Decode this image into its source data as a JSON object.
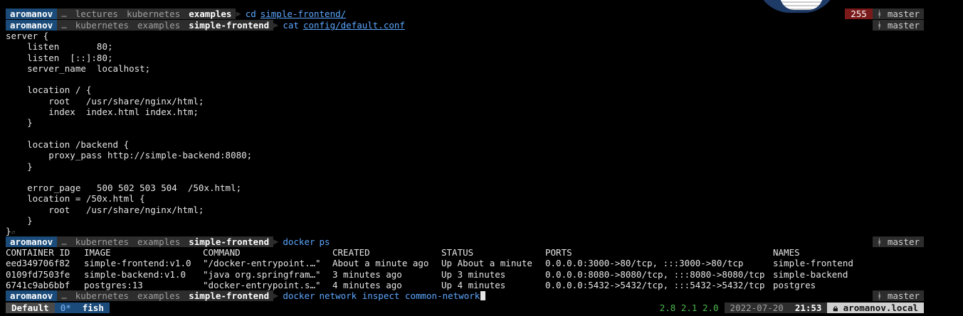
{
  "interrupt": "^C",
  "return_mark": "⏎",
  "prompt_user": "aromanov",
  "ellipsis": "…",
  "crumb_sep": "〉",
  "branch": "ᚼ master",
  "line1": {
    "crumbs": [
      "lectures",
      "kubernetes",
      "examples"
    ],
    "cmd": "cd",
    "arg": "simple-frontend/",
    "exit_code": "255"
  },
  "line2": {
    "crumbs": [
      "kubernetes",
      "examples",
      "simple-frontend"
    ],
    "cmd": "cat",
    "arg": "config/default.conf"
  },
  "conf_lines": [
    "server {",
    "    listen       80;",
    "    listen  [::]:80;",
    "    server_name  localhost;",
    "",
    "    location / {",
    "        root   /usr/share/nginx/html;",
    "        index  index.html index.htm;",
    "    }",
    "",
    "    location /backend {",
    "        proxy_pass http://simple-backend:8080;",
    "    }",
    "",
    "    error_page   500 502 503 504  /50x.html;",
    "    location = /50x.html {",
    "        root   /usr/share/nginx/html;",
    "    }",
    "}"
  ],
  "line3": {
    "crumbs": [
      "kubernetes",
      "examples",
      "simple-frontend"
    ],
    "cmd": "docker",
    "arg": "ps"
  },
  "docker_ps": {
    "headers": [
      "CONTAINER ID",
      "IMAGE",
      "COMMAND",
      "CREATED",
      "STATUS",
      "PORTS",
      "NAMES"
    ],
    "rows": [
      [
        "eed349706f82",
        "simple-frontend:v1.0",
        "\"/docker-entrypoint.…\"",
        "About a minute ago",
        "Up About a minute",
        "0.0.0.0:3000->80/tcp, :::3000->80/tcp",
        "simple-frontend"
      ],
      [
        "0109fd7503fe",
        "simple-backend:v1.0",
        "\"java org.springfram…\"",
        "3 minutes ago",
        "Up 3 minutes",
        "0.0.0.0:8080->8080/tcp, :::8080->8080/tcp",
        "simple-backend"
      ],
      [
        "6741c9ab6bbf",
        "postgres:13",
        "\"docker-entrypoint.s…\"",
        "4 minutes ago",
        "Up 4 minutes",
        "0.0.0.0:5432->5432/tcp, :::5432->5432/tcp",
        "postgres"
      ]
    ]
  },
  "line4": {
    "crumbs": [
      "kubernetes",
      "examples",
      "simple-frontend"
    ],
    "cmd": "docker",
    "arg": "network inspect common-network"
  },
  "statusbar": {
    "session": "Default",
    "window_index": "0*",
    "window_name": "fish",
    "load": "2.8 2.1 2.0",
    "date": "2022-07-20",
    "time": "21:53",
    "host": "aromanov.local",
    "lock_icon": "lock-icon"
  }
}
